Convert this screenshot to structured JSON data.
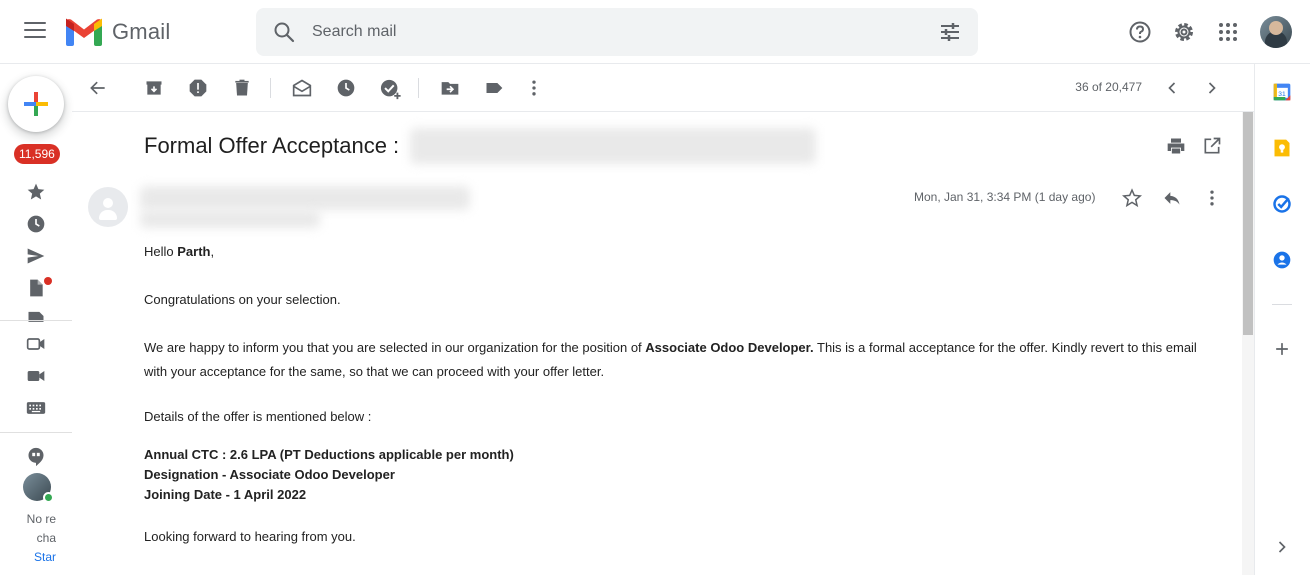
{
  "header": {
    "app_name": "Gmail",
    "search_placeholder": "Search mail"
  },
  "rail": {
    "unread_count": "11,596",
    "chat_status": [
      "No re",
      "cha"
    ],
    "chat_start": "Star"
  },
  "toolbar": {
    "pager": "36 of 20,477"
  },
  "message": {
    "subject": "Formal Offer Acceptance :",
    "date": "Mon, Jan 31, 3:34 PM (1 day ago)",
    "greeting_prefix": "Hello ",
    "greeting_name": "Parth",
    "greeting_suffix": ",",
    "congrats": "Congratulations on your selection.",
    "para_prefix": "We are happy to inform you that you are selected in our organization for the position of ",
    "position": "Associate Odoo Developer.",
    "para_suffix": " This is a formal acceptance for the offer. Kindly revert to this email with your acceptance for the same, so that we can proceed with your offer letter.",
    "details_intro": "Details of the offer is mentioned below :",
    "ctc": "Annual CTC : 2.6 LPA (PT Deductions applicable per month)",
    "designation": "Designation - Associate Odoo Developer",
    "joining": "Joining Date - 1 April 2022",
    "closing": "Looking forward to hearing from you."
  },
  "side_panel": {
    "calendar_day": "31"
  },
  "colors": {
    "red": "#ea4335",
    "blue": "#4285f4",
    "yellow": "#fbbc04",
    "green": "#34a853",
    "badge": "#d93025",
    "icon_gray": "#5f6368"
  }
}
